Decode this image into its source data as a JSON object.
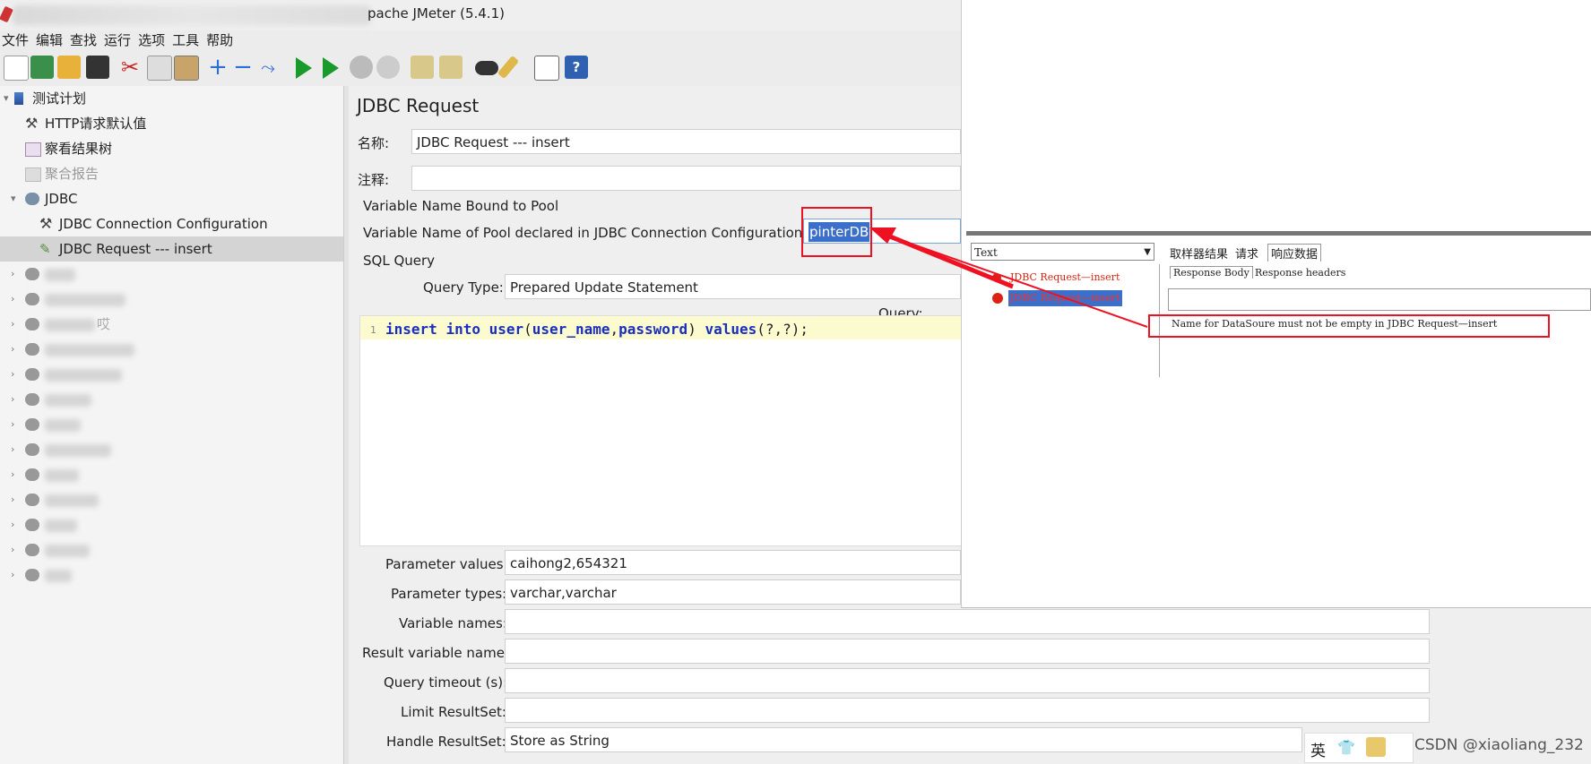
{
  "window": {
    "title": "pache JMeter (5.4.1)"
  },
  "menu": [
    "文件",
    "编辑",
    "查找",
    "运行",
    "选项",
    "工具",
    "帮助"
  ],
  "toolbar_icons": [
    "new-icon",
    "templates-icon",
    "open-icon",
    "save-icon",
    "cut-icon",
    "copy-icon",
    "paste-icon",
    "expand-icon",
    "collapse-icon",
    "toggle-icon",
    "start-icon",
    "start-no-pause-icon",
    "stop-icon",
    "shutdown-icon",
    "clear-icon",
    "clear-all-icon",
    "search-icon",
    "reset-search-icon",
    "function-helper-icon",
    "help-icon"
  ],
  "tree": {
    "root": "测试计划",
    "items": [
      {
        "label": "HTTP请求默认值",
        "icon": "wrench-icon"
      },
      {
        "label": "察看结果树",
        "icon": "graph-icon"
      },
      {
        "label": "聚合报告",
        "icon": "chart-icon"
      }
    ],
    "group": "JDBC",
    "group_children": [
      {
        "label": "JDBC Connection Configuration"
      },
      {
        "label": "JDBC Request  --- insert"
      }
    ],
    "partial_label": "哎"
  },
  "main": {
    "title": "JDBC Request",
    "name_label": "名称:",
    "name_value": "JDBC Request  --- insert",
    "comment_label": "注释:",
    "comment_value": "",
    "pool_section": "Variable Name Bound to Pool",
    "pool_label": "Variable Name of Pool declared in JDBC Connection Configuration:",
    "pool_value": "pinterDB",
    "sql_section": "SQL Query",
    "query_type_label": "Query Type:",
    "query_type_value": "Prepared Update Statement",
    "query_label": "Query:",
    "line_number": "1",
    "code": {
      "kw1": "insert",
      "kw2": "into",
      "kw3": "user",
      "paren": "(",
      "col1": "user_name",
      "comma": ",",
      "col2": "password",
      "close": ")",
      "kw4": "values",
      "tail": "(?,?);"
    },
    "params": [
      {
        "label": "Parameter values:",
        "value": "caihong2,654321"
      },
      {
        "label": "Parameter types:",
        "value": "varchar,varchar"
      },
      {
        "label": "Variable names:",
        "value": ""
      },
      {
        "label": "Result variable name:",
        "value": ""
      },
      {
        "label": "Query timeout (s):",
        "value": ""
      },
      {
        "label": "Limit ResultSet:",
        "value": ""
      },
      {
        "label": "Handle ResultSet:",
        "value": "Store as String"
      }
    ]
  },
  "overlay": {
    "combo_value": "Text",
    "results": [
      "JDBC Request—insert",
      "JDBC Request—insert"
    ],
    "tabs": [
      "取样器结果",
      "请求",
      "响应数据"
    ],
    "subtabs": [
      "Response Body",
      "Response headers"
    ],
    "error": "Name for DataSoure must not be empty in JDBC Request—insert"
  },
  "ime": {
    "lang": "英"
  },
  "watermark": "CSDN @xiaoliang_232",
  "colors": {
    "highlight": "#e12020",
    "selection": "#3b6fc9",
    "keyword": "#1a2fbf"
  }
}
